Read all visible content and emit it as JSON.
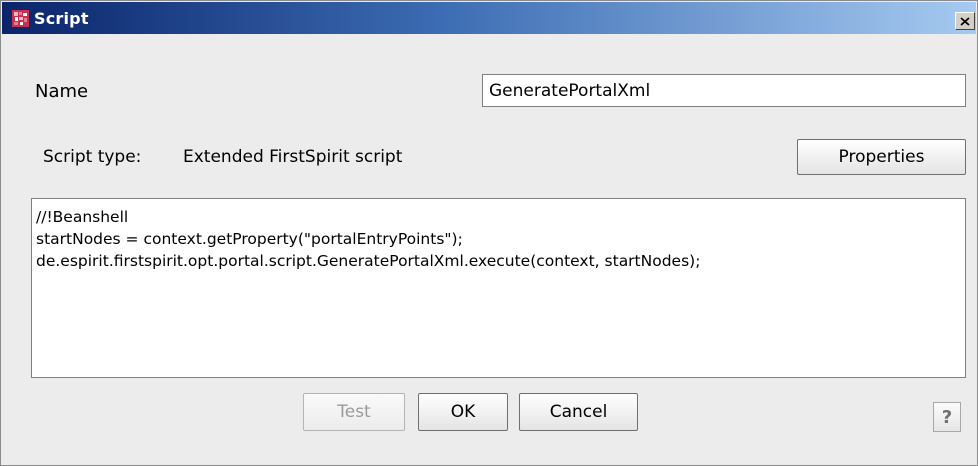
{
  "window": {
    "title": "Script",
    "close_icon": "close-icon",
    "app_icon": "firstspirit-script-icon"
  },
  "form": {
    "name_label": "Name",
    "name_value": "GeneratePortalXml",
    "script_type_label": "Script type:",
    "script_type_value": "Extended FirstSpirit script",
    "properties_label": "Properties"
  },
  "editor": {
    "lines": [
      "//!Beanshell",
      "startNodes = context.getProperty(\"portalEntryPoints\");",
      "de.espirit.firstspirit.opt.portal.script.GeneratePortalXml.execute(context, startNodes);"
    ]
  },
  "buttons": {
    "test_label": "Test",
    "test_enabled": false,
    "ok_label": "OK",
    "cancel_label": "Cancel",
    "help_label": "?"
  },
  "colors": {
    "title_gradient_start": "#0a246a",
    "title_gradient_end": "#a6caf0",
    "dialog_background": "#ececec",
    "app_icon_primary": "#c7304f"
  }
}
